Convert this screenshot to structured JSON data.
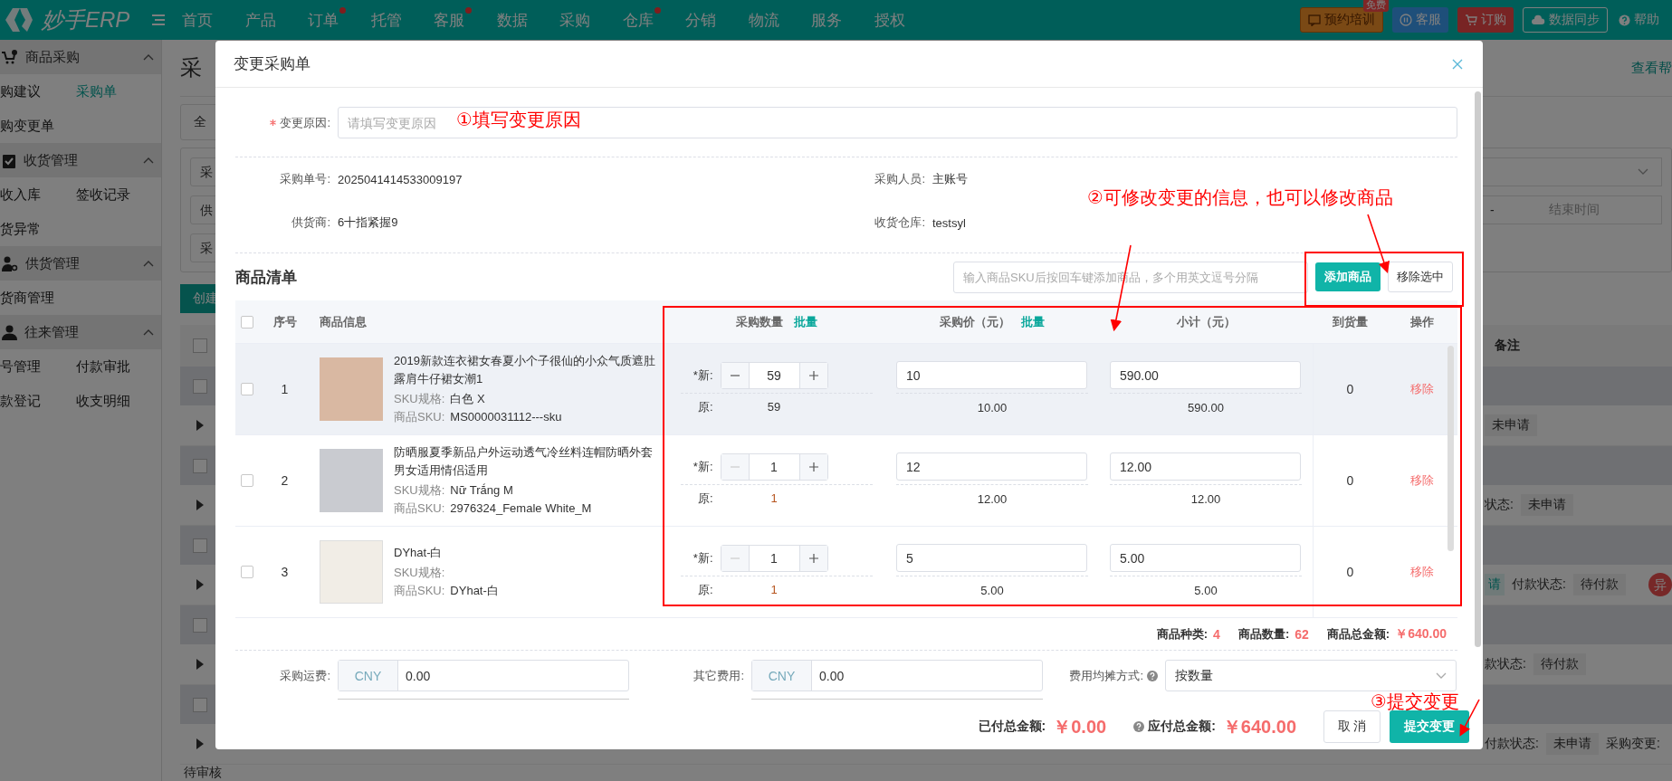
{
  "topbar": {
    "logo": "妙手ERP",
    "nav": [
      {
        "label": "首页",
        "dot": false
      },
      {
        "label": "产品",
        "dot": false
      },
      {
        "label": "订单",
        "dot": true
      },
      {
        "label": "托管",
        "dot": false
      },
      {
        "label": "客服",
        "dot": true
      },
      {
        "label": "数据",
        "dot": false
      },
      {
        "label": "采购",
        "dot": false
      },
      {
        "label": "仓库",
        "dot": true
      },
      {
        "label": "分销",
        "dot": false
      },
      {
        "label": "物流",
        "dot": false
      },
      {
        "label": "服务",
        "dot": false
      },
      {
        "label": "授权",
        "dot": false
      }
    ],
    "actions": [
      {
        "kind": "training",
        "label": "预约培训",
        "badge": "免费"
      },
      {
        "kind": "service",
        "label": "客服"
      },
      {
        "kind": "order",
        "label": "订购"
      },
      {
        "kind": "sync",
        "label": "数据同步"
      },
      {
        "kind": "help",
        "label": "帮助"
      }
    ]
  },
  "sidebar": {
    "groups": [
      {
        "title": "商品采购",
        "expanded": true,
        "items": [
          {
            "label": "购建议",
            "selected": false
          },
          {
            "label": "采购单",
            "selected": true
          },
          {
            "label": "购变更单",
            "selected": false
          }
        ]
      },
      {
        "title": "收货管理",
        "expanded": true,
        "items": [
          {
            "label": "收入库",
            "selected": false
          },
          {
            "label": "签收记录",
            "selected": false
          },
          {
            "label": "货异常",
            "selected": false
          }
        ]
      },
      {
        "title": "供货管理",
        "expanded": true,
        "items": [
          {
            "label": "货商管理",
            "selected": false
          }
        ]
      },
      {
        "title": "往来管理",
        "expanded": true,
        "items": [
          {
            "label": "号管理",
            "selected": false
          },
          {
            "label": "付款审批",
            "selected": false
          },
          {
            "label": "款登记",
            "selected": false
          },
          {
            "label": "收支明细",
            "selected": false
          }
        ]
      }
    ]
  },
  "background_page": {
    "title": "采",
    "help_link": "查看帮",
    "tab": "全",
    "filters": [
      "采",
      "供",
      "采"
    ],
    "date_separator": "-",
    "date_end_placeholder": "结束时间",
    "create_button": "创建",
    "list_header": {
      "checked": false,
      "last": "备注"
    },
    "rows": [
      {
        "checked": false,
        "fragments": [
          {
            "kind": "tag",
            "text": "未申请"
          }
        ]
      },
      {
        "checked": false,
        "fragments": [
          {
            "kind": "label",
            "text": "状态:"
          },
          {
            "kind": "tag",
            "text": "未申请"
          }
        ]
      },
      {
        "checked": false,
        "fragments": [
          {
            "kind": "teal-tag",
            "text": "请"
          },
          {
            "kind": "label",
            "text": "付款状态:"
          },
          {
            "kind": "tag",
            "text": "待付款"
          },
          {
            "kind": "badge",
            "text": "异"
          }
        ]
      },
      {
        "checked": false,
        "fragments": [
          {
            "kind": "label",
            "text": "款状态:"
          },
          {
            "kind": "tag",
            "text": "待付款"
          }
        ]
      },
      {
        "checked": false,
        "fragments": [
          {
            "kind": "label",
            "text": "付款状态:"
          },
          {
            "kind": "tag",
            "text": "未申请"
          },
          {
            "kind": "label",
            "text": "采购变更:"
          }
        ]
      }
    ],
    "footer_status": "待审核"
  },
  "modal": {
    "title": "变更采购单",
    "reason": {
      "label": "变更原因:",
      "required": true,
      "placeholder": "请填写变更原因"
    },
    "info": [
      {
        "label": "采购单号:",
        "value": "2025041414533009197"
      },
      {
        "label": "采购人员:",
        "value": "主账号"
      },
      {
        "label": "供货商:",
        "value": "6十指紧握9"
      },
      {
        "label": "收货仓库:",
        "value": "testsyl"
      }
    ],
    "goods": {
      "title": "商品清单",
      "search_placeholder": "输入商品SKU后按回车键添加商品，多个用英文逗号分隔",
      "add_button": "添加商品",
      "remove_button": "移除选中",
      "all_selected": false,
      "columns": [
        {
          "label": "序号"
        },
        {
          "label": "商品信息"
        },
        {
          "label": "采购数量",
          "action": "批量"
        },
        {
          "label": "采购价（元）",
          "action": "批量"
        },
        {
          "label": "小计（元）"
        },
        {
          "label": "到货量"
        },
        {
          "label": "操作"
        }
      ],
      "rows": [
        {
          "selected": false,
          "hovered": true,
          "index": "1",
          "name": "2019新款连衣裙女春夏小个子很仙的小众气质遮肚露肩牛仔裙女潮1",
          "spec_label": "SKU规格:",
          "spec": "白色 X",
          "sku_label": "商品SKU:",
          "sku": "MS0000031112---sku",
          "new_label": "*新:",
          "qty": "59",
          "minus_disabled": false,
          "price": "10",
          "subtotal": "590.00",
          "orig_label": "原:",
          "orig_qty": "59",
          "orig_qty_warn": false,
          "orig_price": "10.00",
          "orig_subtotal": "590.00",
          "arrived": "0",
          "action": "移除"
        },
        {
          "selected": false,
          "hovered": false,
          "index": "2",
          "name": "防晒服夏季新品户外运动透气冷丝料连帽防晒外套男女适用情侣适用",
          "spec_label": "SKU规格:",
          "spec": "Nữ Trắng M",
          "sku_label": "商品SKU:",
          "sku": "2976324_Female White_M",
          "new_label": "*新:",
          "qty": "1",
          "minus_disabled": true,
          "price": "12",
          "subtotal": "12.00",
          "orig_label": "原:",
          "orig_qty": "1",
          "orig_qty_warn": true,
          "orig_price": "12.00",
          "orig_subtotal": "12.00",
          "arrived": "0",
          "action": "移除"
        },
        {
          "selected": false,
          "hovered": false,
          "index": "3",
          "name": "DYhat-白",
          "spec_label": "SKU规格:",
          "spec": "",
          "sku_label": "商品SKU:",
          "sku": "DYhat-白",
          "new_label": "*新:",
          "qty": "1",
          "minus_disabled": true,
          "price": "5",
          "subtotal": "5.00",
          "orig_label": "原:",
          "orig_qty": "1",
          "orig_qty_warn": true,
          "orig_price": "5.00",
          "orig_subtotal": "5.00",
          "arrived": "0",
          "action": "移除"
        }
      ],
      "summary": [
        {
          "label": "商品种类:",
          "value": "4"
        },
        {
          "label": "商品数量:",
          "value": "62"
        },
        {
          "label": "商品总金额:",
          "value": "￥640.00"
        }
      ]
    },
    "fees": [
      {
        "label": "采购运费:",
        "currency": "CNY",
        "value": "0.00"
      },
      {
        "label": "其它费用:",
        "currency": "CNY",
        "value": "0.00"
      }
    ],
    "split": {
      "label": "费用均摊方式:",
      "value": "按数量"
    },
    "paid": {
      "label": "已付总金额:",
      "value": "￥0.00"
    },
    "payable": {
      "label": "应付总金额:",
      "value": "￥640.00"
    },
    "cancel_button": "取 消",
    "submit_button": "提交变更",
    "annotations": [
      "①填写变更原因",
      "②可修改变更的信息，也可以修改商品",
      "③提交变更"
    ]
  }
}
